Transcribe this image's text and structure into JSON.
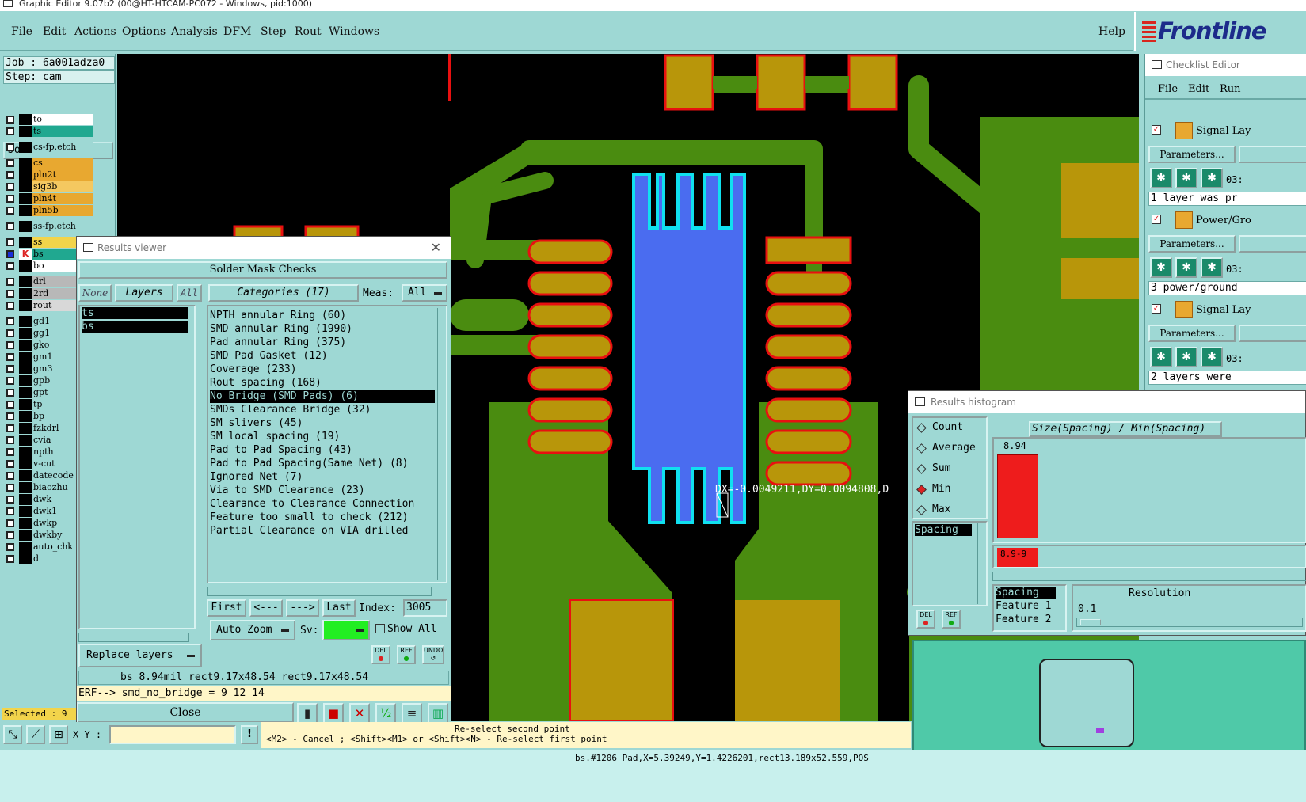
{
  "window": {
    "title": "Graphic Editor 9.07b2 (00@HT-HTCAM-PC072 - Windows, pid:1000)"
  },
  "menu": [
    "File",
    "Edit",
    "Actions",
    "Options",
    "Analysis",
    "DFM",
    "Step",
    "Rout",
    "Windows"
  ],
  "help_label": "Help",
  "logo": "Frontline",
  "job": {
    "job_text": "Job : 6a001adza0",
    "step_text": "Step: cam",
    "matrix_button": "Job Matrix ..."
  },
  "layers": [
    {
      "name": "to",
      "color": "#ffffff"
    },
    {
      "name": "ts",
      "color": "#20a890"
    },
    {
      "name": "cs-fp.etch",
      "color": "#9ed8d4"
    },
    {
      "name": "cs",
      "color": "#e8a830"
    },
    {
      "name": "pln2t",
      "color": "#e8a830"
    },
    {
      "name": "sig3b",
      "color": "#f4c860"
    },
    {
      "name": "pln4t",
      "color": "#e8a830"
    },
    {
      "name": "pln5b",
      "color": "#e8a830"
    },
    {
      "name": "ss-fp.etch",
      "color": "#9ed8d4"
    },
    {
      "name": "ss",
      "color": "#f2d44b"
    },
    {
      "name": "bs",
      "color": "#20a890"
    },
    {
      "name": "bo",
      "color": "#ffffff"
    },
    {
      "name": "drl",
      "color": "#b8b8b8"
    },
    {
      "name": "2rd",
      "color": "#b8b8b8"
    },
    {
      "name": "rout",
      "color": "#d8d8d8"
    },
    {
      "name": "gd1",
      "color": "#9ed8d4"
    },
    {
      "name": "gg1",
      "color": "#9ed8d4"
    },
    {
      "name": "gko",
      "color": "#9ed8d4"
    },
    {
      "name": "gm1",
      "color": "#9ed8d4"
    },
    {
      "name": "gm3",
      "color": "#9ed8d4"
    },
    {
      "name": "gpb",
      "color": "#9ed8d4"
    },
    {
      "name": "gpt",
      "color": "#9ed8d4"
    },
    {
      "name": "tp",
      "color": "#9ed8d4"
    },
    {
      "name": "bp",
      "color": "#9ed8d4"
    },
    {
      "name": "fzkdrl",
      "color": "#9ed8d4"
    },
    {
      "name": "cvia",
      "color": "#9ed8d4"
    },
    {
      "name": "npth",
      "color": "#9ed8d4"
    },
    {
      "name": "v-cut",
      "color": "#9ed8d4"
    },
    {
      "name": "datecode",
      "color": "#9ed8d4"
    },
    {
      "name": "biaozhu",
      "color": "#9ed8d4"
    },
    {
      "name": "dwk",
      "color": "#9ed8d4"
    },
    {
      "name": "dwk1",
      "color": "#9ed8d4"
    },
    {
      "name": "dwkp",
      "color": "#9ed8d4"
    },
    {
      "name": "dwkby",
      "color": "#9ed8d4"
    },
    {
      "name": "auto_chk",
      "color": "#9ed8d4"
    },
    {
      "name": "d",
      "color": "#9ed8d4"
    }
  ],
  "selected_text": "Selected : 9",
  "xy_label": "X Y :",
  "results_viewer": {
    "title": "Results viewer",
    "header": "Solder Mask Checks",
    "none_btn": "None",
    "layers_btn": "Layers",
    "all_btn": "All",
    "categories_btn": "Categories (17)",
    "meas_label": "Meas:",
    "meas_value": "All",
    "layer_list": [
      "ts",
      "bs"
    ],
    "categories": [
      "NPTH annular Ring (60)",
      "SMD annular Ring (1990)",
      "Pad annular Ring (375)",
      "SMD Pad Gasket (12)",
      "Coverage (233)",
      "Rout spacing (168)",
      "No Bridge (SMD Pads) (6)",
      "SMDs Clearance Bridge (32)",
      "SM slivers (45)",
      "SM local spacing (19)",
      "Pad to Pad Spacing (43)",
      "Pad to Pad Spacing(Same Net) (8)",
      "Ignored Net (7)",
      "Via to SMD Clearance (23)",
      "Clearance to Clearance Connection",
      "Feature too small to check (212)",
      "Partial Clearance on VIA drilled"
    ],
    "selected_category_index": 6,
    "first_btn": "First",
    "prev_btn": "<---",
    "next_btn": "--->",
    "last_btn": "Last",
    "index_label": "Index:",
    "index_value": "3005",
    "auto_zoom_label": "Auto Zoom",
    "sv_label": "Sv:",
    "show_all_label": "Show All",
    "replace_layers_label": "Replace layers",
    "del_label": "DEL",
    "ref_label": "REF",
    "undo_label": "UNDO",
    "info_line": "bs 8.94mil  rect9.17x48.54  rect9.17x48.54",
    "erf_line": "ERF--> smd_no_bridge = 9 12 14",
    "close_btn": "Close"
  },
  "checklist_editor": {
    "title": "Checklist Editor",
    "menu": [
      "File",
      "Edit",
      "Run"
    ],
    "sections": [
      {
        "name": "Signal Lay",
        "params": "Parameters...",
        "code": "03:",
        "status": "1 layer was pr"
      },
      {
        "name": "Power/Gro",
        "params": "Parameters...",
        "code": "03:",
        "status": "3 power/ground"
      },
      {
        "name": "Signal Lay",
        "params": "Parameters...",
        "code": "03:",
        "status": "2 layers were"
      }
    ]
  },
  "histogram": {
    "title": "Results histogram",
    "options": [
      "Count",
      "Average",
      "Sum",
      "Min",
      "Max"
    ],
    "selected_option": "Min",
    "axis_title": "Size(Spacing) / Min(Spacing)",
    "bar_value_label": "8.94",
    "bar_fraction": 1.0,
    "range_label": "8.9-9",
    "spacing_list": [
      "Spacing"
    ],
    "features": [
      "Spacing",
      "Feature 1",
      "Feature 2"
    ],
    "resolution_label": "Resolution",
    "resolution_value": "0.1",
    "del_label": "DEL",
    "ref_label": "REF"
  },
  "canvas": {
    "measure_text": "DX=-0.0049211,DY=0.0094808,D",
    "accent_copper": "#b8960a",
    "accent_green": "#4a8c10",
    "accent_blue": "#4a6cf0",
    "accent_red": "#e81010",
    "accent_cyan": "#10e0f0"
  },
  "status": {
    "prompt1": "Re-select second point",
    "prompt2": "<M2> - Cancel ; <Shift><M1> or <Shift><N> - Re-select first point",
    "feature_info": "bs.#1206 Pad,X=5.39249,Y=1.4226201,rect13.189x52.559,POS"
  }
}
